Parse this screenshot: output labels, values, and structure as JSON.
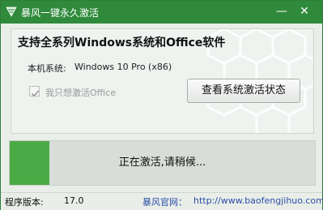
{
  "window": {
    "title": "暴风一键永久激活",
    "accent_color": "#2f8a3b"
  },
  "titlebar": {
    "minimize_glyph": "—",
    "close_glyph": "✕",
    "app_icon": "tornado-icon"
  },
  "panel": {
    "headline": "支持全系列Windows系统和Office软件",
    "system_label": "本机系统:",
    "system_value": "Windows 10 Pro (x86)",
    "checkbox_label": "我只想激活Office",
    "checkbox_checked": true,
    "checkbox_disabled": true,
    "status_button_label": "查看系统激活状态"
  },
  "progress": {
    "text": "正在激活,请稍候...",
    "fraction": 0.13,
    "fill_color": "#4aaa45"
  },
  "statusbar": {
    "version_label": "程序版本:",
    "version_value": "17.0",
    "site_label": "暴风官网：",
    "site_url": "http://www.baofengjihuo.com"
  }
}
